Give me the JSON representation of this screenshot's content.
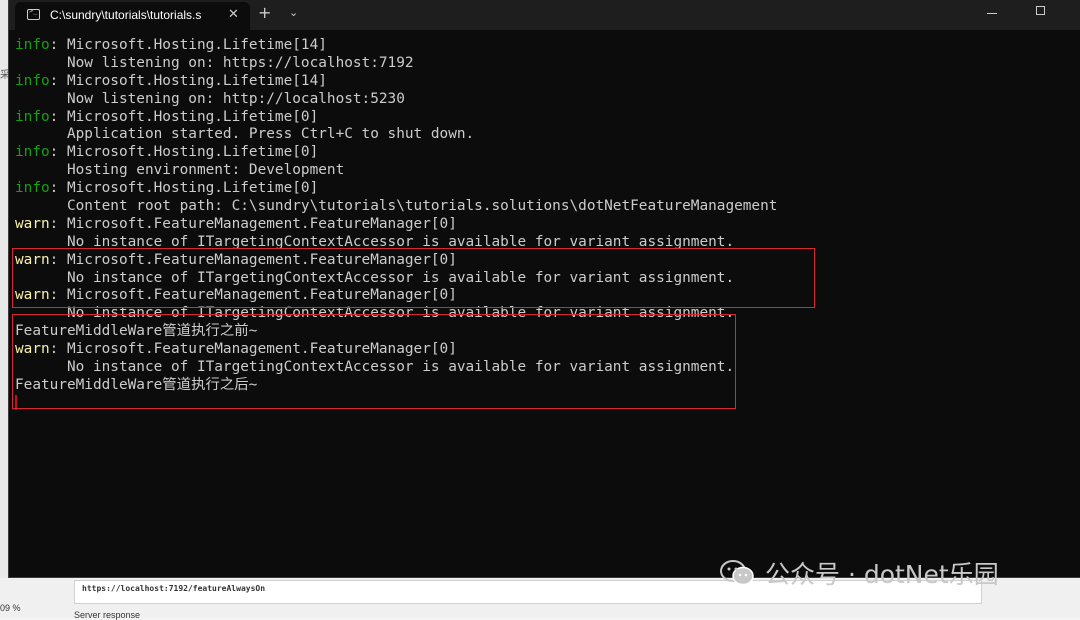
{
  "background_app": {
    "side_text": "采",
    "url": "https://localhost:7192/featureAlwaysOn",
    "zoom": "09 %",
    "server_response": "Server response"
  },
  "terminal": {
    "tab_title": "C:\\sundry\\tutorials\\tutorials.s",
    "close_glyph": "✕",
    "new_tab_glyph": "+",
    "dropdown_glyph": "⌄",
    "lines": [
      {
        "level": "info",
        "text": ": Microsoft.Hosting.Lifetime[14]"
      },
      {
        "level": "",
        "text": "      Now listening on: https://localhost:7192"
      },
      {
        "level": "info",
        "text": ": Microsoft.Hosting.Lifetime[14]"
      },
      {
        "level": "",
        "text": "      Now listening on: http://localhost:5230"
      },
      {
        "level": "info",
        "text": ": Microsoft.Hosting.Lifetime[0]"
      },
      {
        "level": "",
        "text": "      Application started. Press Ctrl+C to shut down."
      },
      {
        "level": "info",
        "text": ": Microsoft.Hosting.Lifetime[0]"
      },
      {
        "level": "",
        "text": "      Hosting environment: Development"
      },
      {
        "level": "info",
        "text": ": Microsoft.Hosting.Lifetime[0]"
      },
      {
        "level": "",
        "text": "      Content root path: C:\\sundry\\tutorials\\tutorials.solutions\\dotNetFeatureManagement"
      },
      {
        "level": "warn",
        "text": ": Microsoft.FeatureManagement.FeatureManager[0]"
      },
      {
        "level": "",
        "text": "      No instance of ITargetingContextAccessor is available for variant assignment."
      },
      {
        "level": "warn",
        "text": ": Microsoft.FeatureManagement.FeatureManager[0]"
      },
      {
        "level": "",
        "text": "      No instance of ITargetingContextAccessor is available for variant assignment."
      },
      {
        "level": "warn",
        "text": ": Microsoft.FeatureManagement.FeatureManager[0]"
      },
      {
        "level": "",
        "text": "      No instance of ITargetingContextAccessor is available for variant assignment."
      },
      {
        "level": "",
        "text": "FeatureMiddleWare管道执行之前~"
      },
      {
        "level": "warn",
        "text": ": Microsoft.FeatureManagement.FeatureManager[0]"
      },
      {
        "level": "",
        "text": "      No instance of ITargetingContextAccessor is available for variant assignment."
      },
      {
        "level": "",
        "text": "FeatureMiddleWare管道执行之后~"
      }
    ]
  },
  "watermark": {
    "icon": "wechat-icon",
    "text": "公众号 · dotNet乐园"
  },
  "colors": {
    "info": "#13a10e",
    "warn": "#f9f1a5",
    "highlight": "#d7282f",
    "terminal_bg": "#0c0c0c"
  }
}
